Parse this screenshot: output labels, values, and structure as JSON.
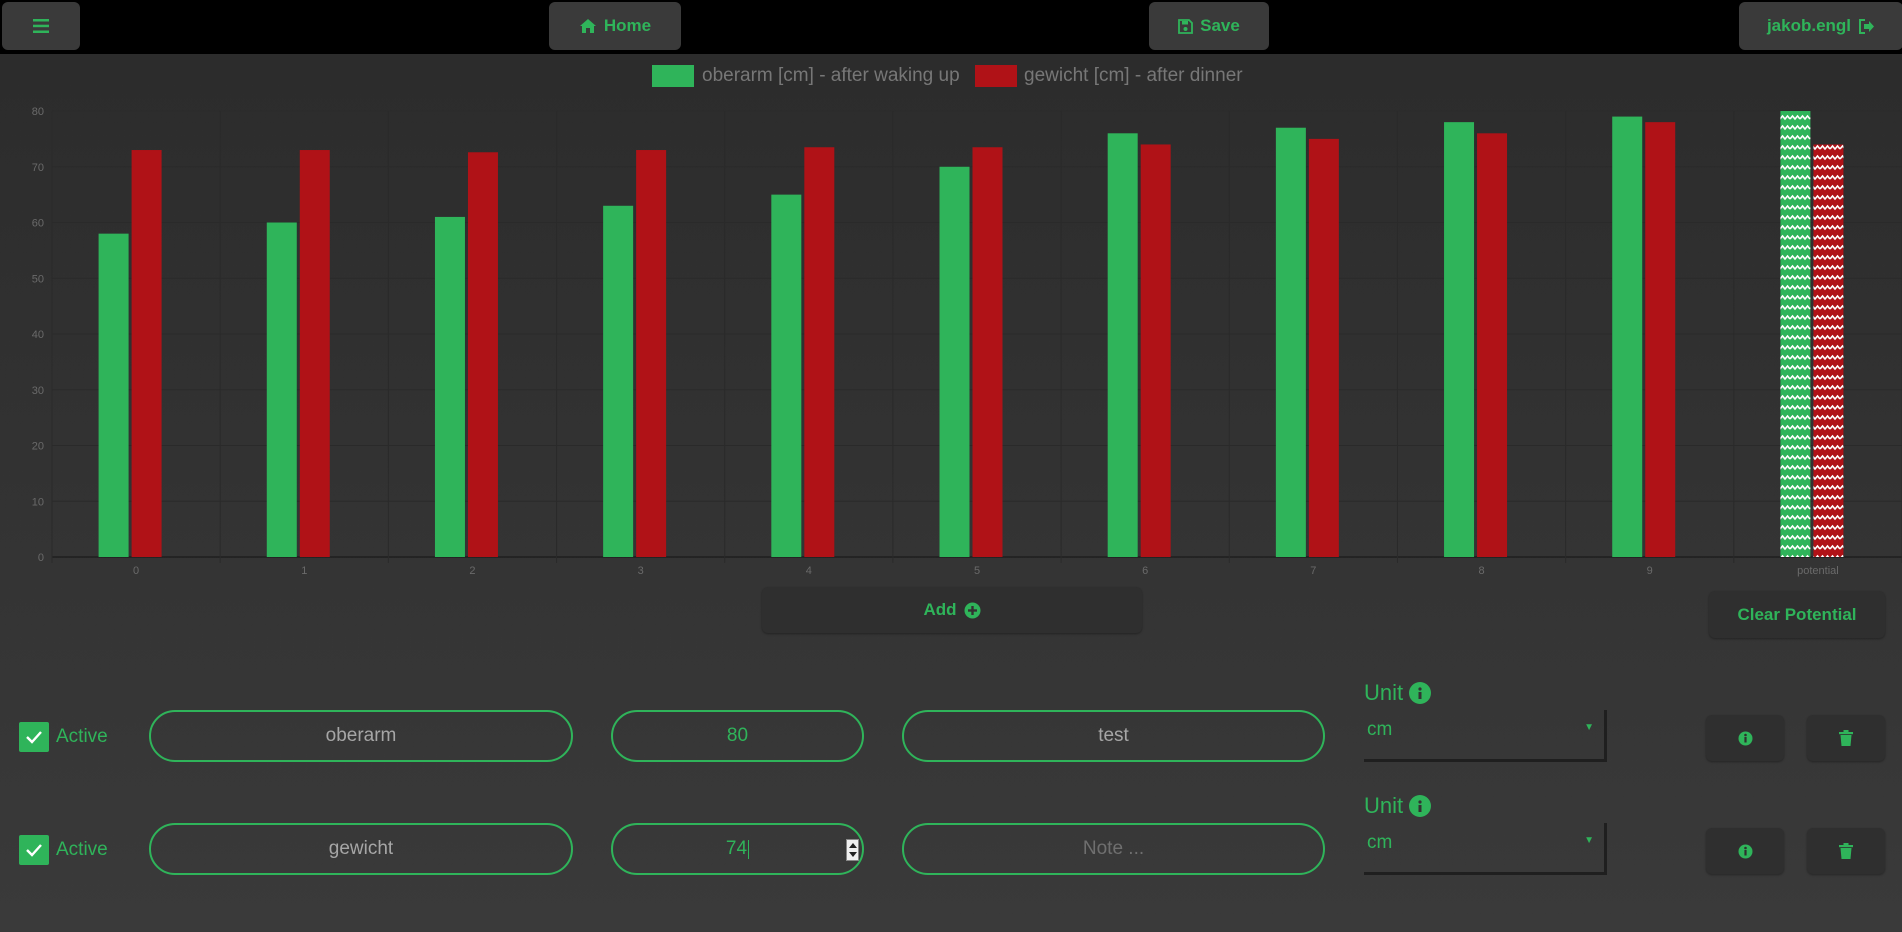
{
  "topbar": {
    "menu_icon": "hamburger-icon",
    "home_label": "Home",
    "home_icon": "home-icon",
    "save_label": "Save",
    "save_icon": "floppy-icon",
    "user_label": "jakob.engl",
    "user_icon": "sign-out-icon"
  },
  "colors": {
    "accent": "#2fb45a",
    "series_green": "#2fb45a",
    "series_red": "#b01217",
    "topbar": "#000000",
    "panel": "#333333"
  },
  "chart_data": {
    "type": "bar",
    "categories": [
      "0",
      "1",
      "2",
      "3",
      "4",
      "5",
      "6",
      "7",
      "8",
      "9",
      "potential"
    ],
    "series": [
      {
        "name": "oberarm [cm] - after waking up",
        "color": "#2fb45a",
        "values": [
          58,
          60,
          61,
          63,
          65,
          70,
          76,
          77,
          78,
          79,
          80
        ]
      },
      {
        "name": "gewicht [cm] - after dinner",
        "color": "#b01217",
        "values": [
          73,
          73,
          72.6,
          73,
          73.5,
          73.5,
          74,
          75,
          76,
          78,
          74
        ]
      }
    ],
    "potential_category": "potential",
    "potential_pattern": "zigzag",
    "ylim": [
      0,
      80
    ],
    "yticks": [
      0,
      10,
      20,
      30,
      40,
      50,
      60,
      70,
      80
    ],
    "grid": true,
    "legend_position": "top-center",
    "title": "",
    "xlabel": "",
    "ylabel": ""
  },
  "actions": {
    "add_label": "Add",
    "add_icon": "plus-circle-icon",
    "clear_label": "Clear Potential"
  },
  "rows": [
    {
      "active_label": "Active",
      "active": true,
      "name": "oberarm",
      "value": "80",
      "note": "test",
      "note_placeholder": "Note ...",
      "unit_label": "Unit",
      "unit": "cm"
    },
    {
      "active_label": "Active",
      "active": true,
      "name": "gewicht",
      "value": "74",
      "note": "",
      "note_placeholder": "Note ...",
      "unit_label": "Unit",
      "unit": "cm"
    }
  ]
}
